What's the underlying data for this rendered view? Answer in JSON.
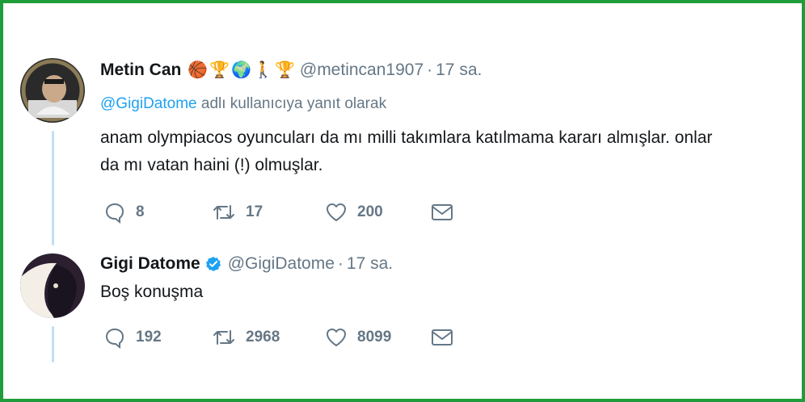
{
  "tweets": [
    {
      "name": "Metin Can",
      "emojis": [
        "🏀",
        "🏆",
        "🌍",
        "🚶",
        "🏆"
      ],
      "handle": "@metincan1907",
      "dot": "·",
      "time": "17 sa.",
      "reply_to_mention": "@GigiDatome",
      "reply_to_suffix": "adlı kullanıcıya yanıt olarak",
      "text_line1": "anam olympiacos oyuncuları da mı milli takımlara katılmama kararı almışlar. onlar",
      "text_line2": "da mı vatan haini (!) olmuşlar.",
      "replies": "8",
      "retweets": "17",
      "likes": "200"
    },
    {
      "name": "Gigi Datome",
      "verified": true,
      "handle": "@GigiDatome",
      "dot": "·",
      "time": "17 sa.",
      "text": "Boş konuşma",
      "replies": "192",
      "retweets": "2968",
      "likes": "8099"
    }
  ],
  "icons": {
    "reply": "reply-icon",
    "retweet": "retweet-icon",
    "like": "heart-icon",
    "dm": "envelope-icon",
    "verified": "verified-badge-icon"
  },
  "colors": {
    "frame": "#1f9d3a",
    "mention": "#1da1f2",
    "muted": "#657786",
    "thread_line": "#bfe0f4"
  }
}
